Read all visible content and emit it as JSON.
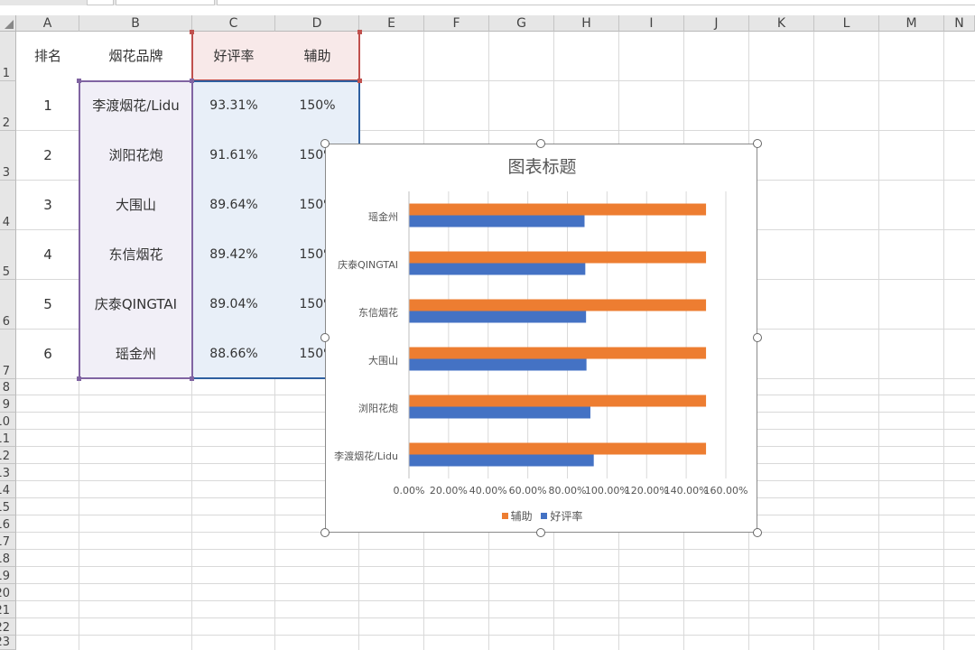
{
  "sheet": {
    "columns": [
      "A",
      "B",
      "C",
      "D",
      "E",
      "F",
      "G",
      "H",
      "I",
      "J",
      "K",
      "L",
      "M",
      "N"
    ],
    "rows": [
      "1",
      "2",
      "3",
      "4",
      "5",
      "6",
      "7",
      "8",
      "9",
      "10",
      "11",
      "12",
      "13",
      "14",
      "15",
      "16",
      "17",
      "18",
      "19",
      "20",
      "21",
      "22",
      "23"
    ],
    "header": {
      "rank": "排名",
      "brand": "烟花品牌",
      "rating": "好评率",
      "aux": "辅助"
    },
    "data_rows": [
      {
        "rank": "1",
        "brand": "李渡烟花/Lidu",
        "rating": "93.31%",
        "aux": "150%"
      },
      {
        "rank": "2",
        "brand": "浏阳花炮",
        "rating": "91.61%",
        "aux": "150%"
      },
      {
        "rank": "3",
        "brand": "大围山",
        "rating": "89.64%",
        "aux": "150%"
      },
      {
        "rank": "4",
        "brand": "东信烟花",
        "rating": "89.42%",
        "aux": "150%"
      },
      {
        "rank": "5",
        "brand": "庆泰QINGTAI",
        "rating": "89.04%",
        "aux": "150%"
      },
      {
        "rank": "6",
        "brand": "瑶金州",
        "rating": "88.66%",
        "aux": "150%"
      }
    ]
  },
  "chart_data": {
    "type": "bar",
    "orientation": "horizontal",
    "title": "图表标题",
    "categories": [
      "李渡烟花/Lidu",
      "浏阳花炮",
      "大围山",
      "东信烟花",
      "庆泰QINGTAI",
      "瑶金州"
    ],
    "series": [
      {
        "name": "辅助",
        "values": [
          1.5,
          1.5,
          1.5,
          1.5,
          1.5,
          1.5
        ],
        "color": "#ed7d31"
      },
      {
        "name": "好评率",
        "values": [
          0.9331,
          0.9161,
          0.8964,
          0.8942,
          0.8904,
          0.8866
        ],
        "color": "#4472c4"
      }
    ],
    "xticks": [
      "0.00%",
      "20.00%",
      "40.00%",
      "60.00%",
      "80.00%",
      "100.00%",
      "120.00%",
      "140.00%",
      "160.00%"
    ],
    "xlim": [
      0,
      1.6
    ],
    "grid": true,
    "legend_position": "bottom"
  }
}
